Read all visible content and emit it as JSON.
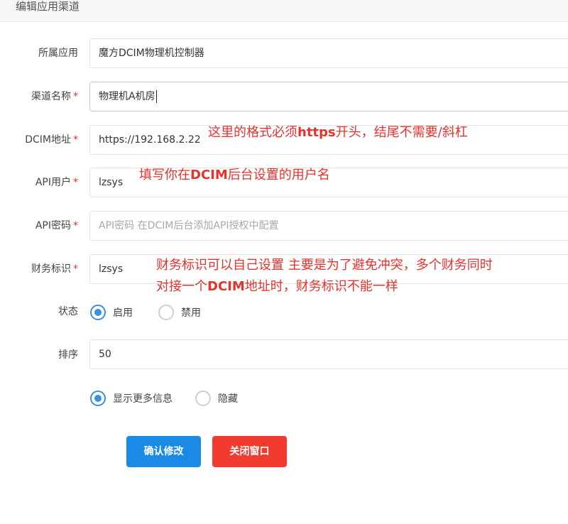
{
  "header": {
    "title": "编辑应用渠道"
  },
  "form": {
    "app": {
      "label": "所属应用",
      "required": "",
      "value": "魔方DCIM物理机控制器"
    },
    "channel_name": {
      "label": "渠道名称",
      "required": "*",
      "value": "物理机A机房"
    },
    "dcim_url": {
      "label": "DCIM地址",
      "required": "*",
      "value": "https://192.168.2.22"
    },
    "api_user": {
      "label": "API用户",
      "required": "*",
      "value": "lzsys"
    },
    "api_password": {
      "label": "API密码",
      "required": "*",
      "value": "",
      "placeholder": "API密码 在DCIM后台添加API授权中配置"
    },
    "finance_id": {
      "label": "财务标识",
      "required": "*",
      "value": "lzsys"
    },
    "status": {
      "label": "状态",
      "options": [
        "启用",
        "禁用"
      ],
      "selected": "启用"
    },
    "sort": {
      "label": "排序",
      "value": "50"
    },
    "info_display": {
      "options": [
        "显示更多信息",
        "隐藏"
      ],
      "selected": "显示更多信息"
    }
  },
  "buttons": {
    "confirm": "确认修改",
    "close": "关闭窗口"
  },
  "annotations": {
    "dcim_url_note_1": "这里的格式必须",
    "dcim_url_note_2": "https",
    "dcim_url_note_3": "开头，结尾不需要/斜杠",
    "api_user_note_1": "填写你在",
    "api_user_note_2": "DCIM",
    "api_user_note_3": "后台设置的用户名",
    "finance_note_line1": "财务标识可以自己设置 主要是为了避免冲突，多个财务同时",
    "finance_note_line2a": "对接一个",
    "finance_note_line2b": "DCIM",
    "finance_note_line2c": "地址时，财务标识不能一样"
  },
  "colors": {
    "primary": "#1a8ae6",
    "danger": "#f23a2e",
    "annotation": "#e8312d",
    "radio_active": "#3a8fe0"
  }
}
